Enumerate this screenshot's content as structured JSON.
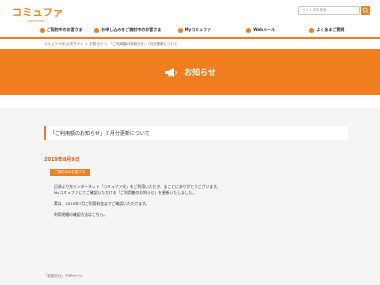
{
  "header": {
    "logo_text": "コミュファ",
    "logo_sub": "commufa",
    "search_placeholder": "サイト内を検索"
  },
  "nav": {
    "items": [
      {
        "label": "ご契約中のお客さま",
        "icon": "user-icon"
      },
      {
        "label": "お申し込みをご検討中のお客さま",
        "icon": "document-icon"
      },
      {
        "label": "Myコミュファ",
        "icon": "lock-icon"
      },
      {
        "label": "Webメール",
        "icon": "mail-icon"
      },
      {
        "label": "よくあるご質問",
        "icon": "question-icon"
      }
    ]
  },
  "breadcrumb": "コミュファ光 公式サイト ＞ お知らせ ＞ 「ご利用額のお知らせ」7月分更新について",
  "banner": {
    "title": "お知らせ",
    "icon": "megaphone-icon"
  },
  "article": {
    "headline": "「ご利用額のお知らせ」７月分更新について",
    "date": "2019年8月9日",
    "badge": "ご契約中のお客さま",
    "paragraphs": [
      "日頃より光インターネット「コミュファ光」をご利用いただき、まことにありがとうございます。",
      "Myコミュファにてご確認いただける「ご利用額のお知らせ」を更新いたしました。",
      "",
      "実は、2019年7月ご利用料金までご確認いただけます。",
      "",
      "利用明細の確認方法はこちら。"
    ],
    "back_link": "「お知らせ」TOPページ"
  },
  "colors": {
    "accent": "#f07d1e",
    "date": "#e55e0c",
    "panel": "#f5f5f5"
  }
}
